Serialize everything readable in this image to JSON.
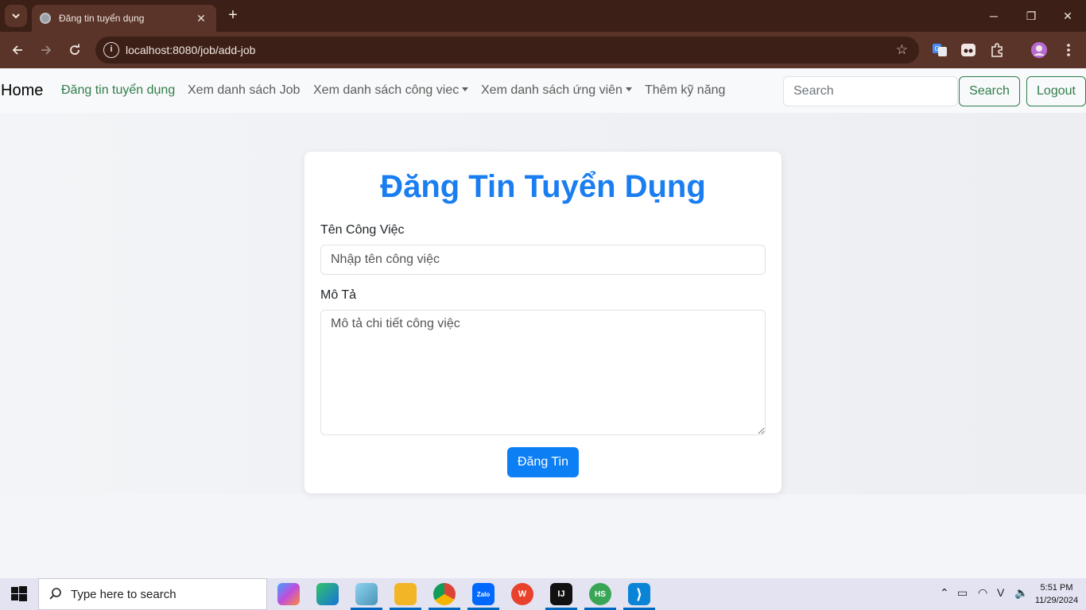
{
  "browser": {
    "tab_title": "Đăng tin tuyển dụng",
    "tab_close": "✕",
    "new_tab": "+",
    "url": "localhost:8080/job/add-job",
    "window_controls": {
      "minimize": "─",
      "restore": "❐",
      "close": "✕"
    }
  },
  "navbar": {
    "brand": "Home",
    "links": [
      {
        "label": "Đăng tin tuyển dụng",
        "active": true
      },
      {
        "label": "Xem danh sách Job"
      },
      {
        "label": "Xem danh sách công viec",
        "dropdown": true
      },
      {
        "label": "Xem danh sách ứng viên",
        "dropdown": true
      },
      {
        "label": "Thêm kỹ năng"
      }
    ],
    "search_placeholder": "Search",
    "search_button": "Search",
    "logout_button": "Logout"
  },
  "form": {
    "title": "Đăng Tin Tuyển Dụng",
    "job_name_label": "Tên Công Việc",
    "job_name_placeholder": "Nhập tên công việc",
    "description_label": "Mô Tả",
    "description_placeholder": "Mô tả chi tiết công việc",
    "submit_label": "Đăng Tin"
  },
  "taskbar": {
    "search_placeholder": "Type here to search",
    "time": "5:51 PM",
    "date": "11/29/2024",
    "apps": [
      {
        "icon": "copilot-icon",
        "color": "#7b5cf5"
      },
      {
        "icon": "edge-icon",
        "color": "#1f9a6f"
      },
      {
        "icon": "notepad-icon",
        "color": "#5aa9c9"
      },
      {
        "icon": "file-explorer-icon",
        "color": "#f2b527"
      },
      {
        "icon": "chrome-icon",
        "color": "#db4437"
      },
      {
        "icon": "zalo-icon",
        "color": "#0068ff",
        "text": "Zalo"
      },
      {
        "icon": "wps-icon",
        "color": "#e8412c",
        "text": "W"
      },
      {
        "icon": "intellij-icon",
        "color": "#111111",
        "text": "IJ"
      },
      {
        "icon": "heidisql-icon",
        "color": "#3aa655",
        "text": "HS"
      },
      {
        "icon": "vscode-icon",
        "color": "#0a84d6",
        "text": "⟩"
      }
    ]
  }
}
